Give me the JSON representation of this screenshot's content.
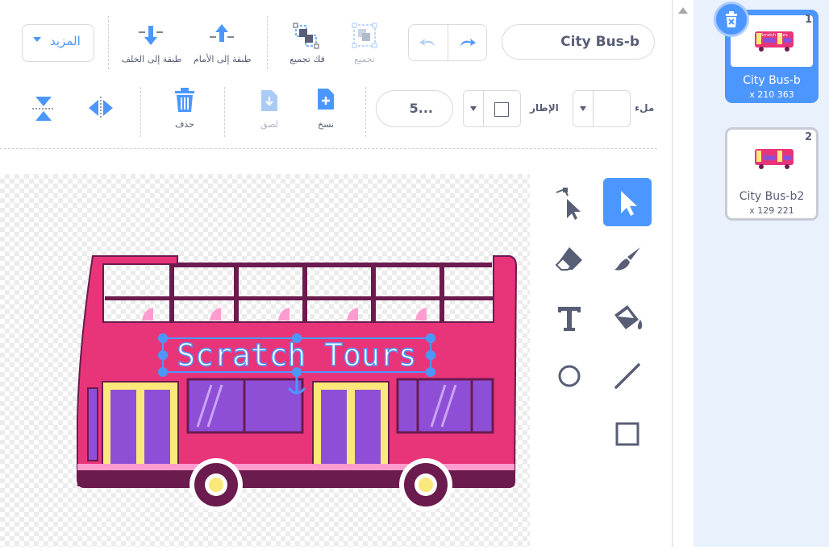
{
  "toolbar": {
    "costume_name": "City Bus-b",
    "group_label": "تجميع",
    "ungroup_label": "فك تجميع",
    "forward_label": "طبقة إلى الأمام",
    "backward_label": "طبقة إلى الخلف",
    "more_label": "المزيد",
    "fill_label": "ملء",
    "outline_label": "الإطار",
    "outline_width": "5...",
    "copy_label": "نسخ",
    "paste_label": "لصق",
    "delete_label": "حذف"
  },
  "costumes": [
    {
      "index": "1",
      "name": "City Bus-b",
      "size": "x 210 363"
    },
    {
      "index": "2",
      "name": "City Bus-b2",
      "size": "x 129 221"
    }
  ],
  "canvas": {
    "bus_text": "Scratch Tours"
  },
  "colors": {
    "accent": "#4c97ff",
    "bus_body": "#e8357a",
    "bus_frame": "#6b1b4e",
    "window": "#8e4fd6",
    "door": "#fbe87b"
  },
  "icons": [
    "trash-icon",
    "undo-icon",
    "redo-icon",
    "group-icon",
    "ungroup-icon",
    "forward-icon",
    "backward-icon",
    "copy-icon",
    "paste-icon",
    "flip-horizontal-icon",
    "flip-vertical-icon",
    "reshape-icon",
    "select-icon",
    "eraser-icon",
    "brush-icon",
    "text-icon",
    "fill-icon",
    "circle-icon",
    "line-icon",
    "rectangle-icon"
  ]
}
